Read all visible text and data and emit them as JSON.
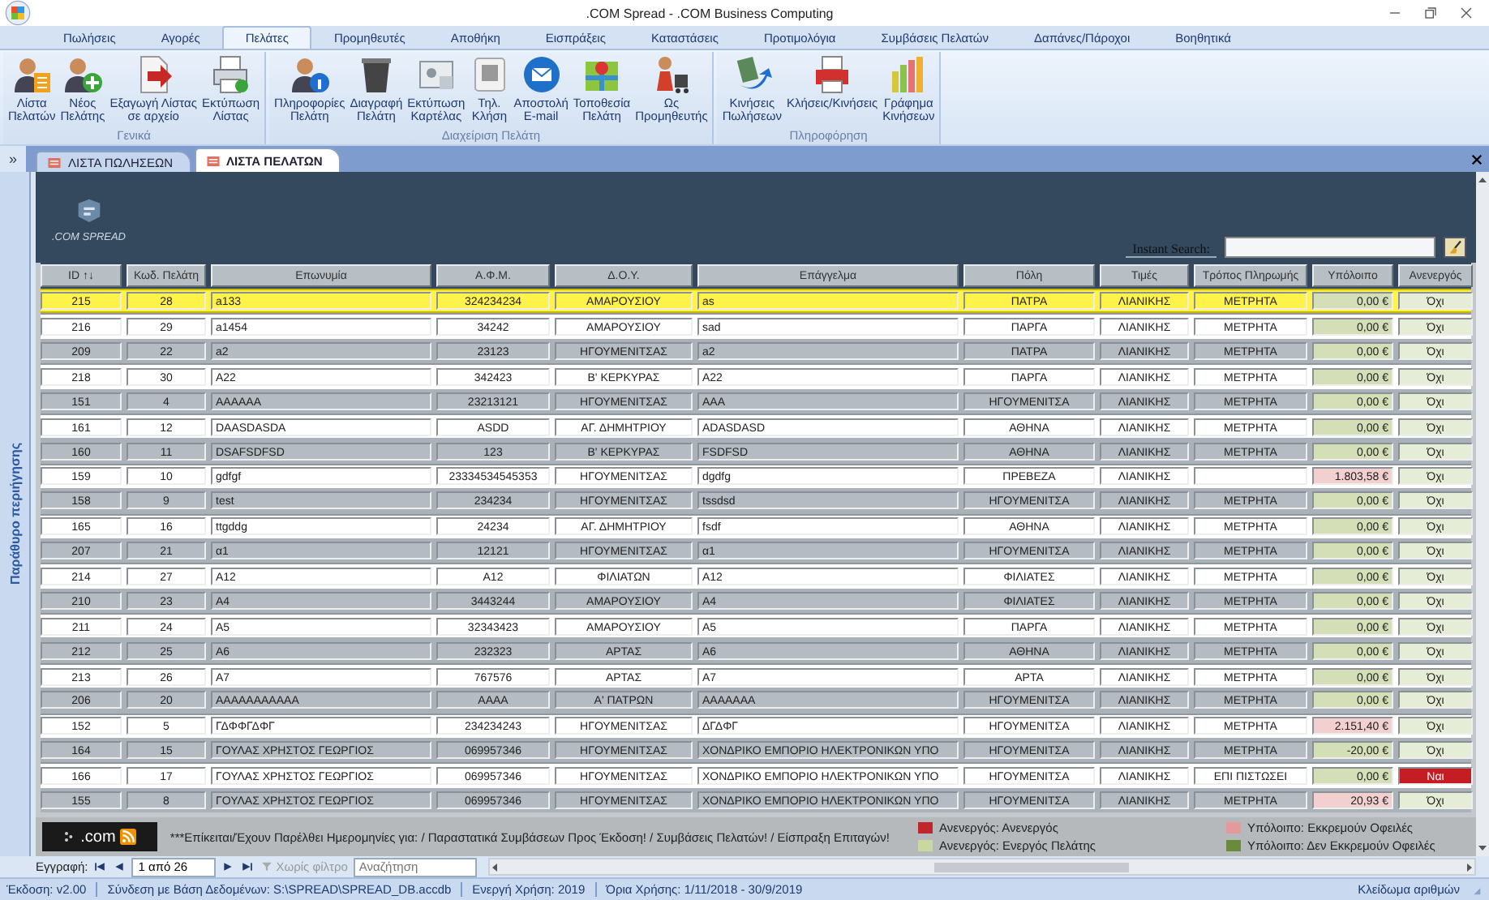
{
  "window": {
    "title": ".COM Spread - .COM Business Computing"
  },
  "ribbon_tabs": [
    {
      "label": "Πωλήσεις",
      "selected": false
    },
    {
      "label": "Αγορές",
      "selected": false
    },
    {
      "label": "Πελάτες",
      "selected": true
    },
    {
      "label": "Προμηθευτές",
      "selected": false
    },
    {
      "label": "Αποθήκη",
      "selected": false
    },
    {
      "label": "Εισπράξεις",
      "selected": false
    },
    {
      "label": "Καταστάσεις",
      "selected": false
    },
    {
      "label": "Προτιμολόγια",
      "selected": false
    },
    {
      "label": "Συμβάσεις Πελατών",
      "selected": false
    },
    {
      "label": "Δαπάνες/Πάροχοι",
      "selected": false
    },
    {
      "label": "Βοηθητικά",
      "selected": false
    }
  ],
  "ribbon_groups": [
    {
      "title": "Γενικά",
      "buttons": [
        {
          "label": [
            "Λίστα",
            "Πελατών"
          ]
        },
        {
          "label": [
            "Νέος",
            "Πελάτης"
          ]
        },
        {
          "label": [
            "Εξαγωγή Λίστας",
            "σε αρχείο"
          ]
        },
        {
          "label": [
            "Εκτύπωση",
            "Λίστας"
          ]
        }
      ]
    },
    {
      "title": "Διαχείριση Πελάτη",
      "buttons": [
        {
          "label": [
            "Πληροφορίες",
            "Πελάτη"
          ]
        },
        {
          "label": [
            "Διαγραφή",
            "Πελάτη"
          ]
        },
        {
          "label": [
            "Εκτύπωση",
            "Καρτέλας"
          ]
        },
        {
          "label": [
            "Τηλ.",
            "Κλήση"
          ]
        },
        {
          "label": [
            "Αποστολή",
            "E-mail"
          ]
        },
        {
          "label": [
            "Τοποθεσία",
            "Πελάτη"
          ]
        },
        {
          "label": [
            "Ως",
            "Προμηθευτής"
          ]
        }
      ]
    },
    {
      "title": "Πληροφόρηση",
      "buttons": [
        {
          "label": [
            "Κινήσεις",
            "Πωλήσεων"
          ]
        },
        {
          "label": [
            "Κλήσεις/Κινήσεις"
          ]
        },
        {
          "label": [
            "Γράφημα",
            "Κινήσεων"
          ]
        }
      ]
    }
  ],
  "doc_tabs": [
    {
      "label": "ΛΙΣΤΑ ΠΩΛΗΣΕΩΝ",
      "selected": false
    },
    {
      "label": "ΛΙΣΤΑ ΠΕΛΑΤΩΝ",
      "selected": true
    }
  ],
  "nav_pane": {
    "expand": "»",
    "label": "Παράθυρο περιήγησης"
  },
  "logo": ".COM SPREAD",
  "search": {
    "label": "Instant Search:"
  },
  "columns": [
    "ID ↑↓",
    "Κωδ. Πελάτη",
    "Επωνυμία",
    "Α.Φ.Μ.",
    "Δ.Ο.Υ.",
    "Επάγγελμα",
    "Πόλη",
    "Τιμές",
    "Τρόπος Πληρωμής",
    "Υπόλοιπο",
    "Ανενεργός"
  ],
  "rows": [
    {
      "id": "215",
      "code": "28",
      "name": "a133",
      "afm": "324234234",
      "doy": "ΑΜΑΡΟΥΣΙΟΥ",
      "profession": "as",
      "city": "ΠΑΤΡΑ",
      "prices": "ΛΙΑΝΙΚΗΣ",
      "payment": "ΜΕΤΡΗΤΑ",
      "balance": "0,00 €",
      "owed": false,
      "inactive_text": "Όχι",
      "inactive": false,
      "selected": true
    },
    {
      "id": "216",
      "code": "29",
      "name": "a1454",
      "afm": "34242",
      "doy": "ΑΜΑΡΟΥΣΙΟΥ",
      "profession": "sad",
      "city": "ΠΑΡΓΑ",
      "prices": "ΛΙΑΝΙΚΗΣ",
      "payment": "ΜΕΤΡΗΤΑ",
      "balance": "0,00 €",
      "owed": false,
      "inactive_text": "Όχι",
      "inactive": false,
      "selected": false
    },
    {
      "id": "209",
      "code": "22",
      "name": "a2",
      "afm": "23123",
      "doy": "ΗΓΟΥΜΕΝΙΤΣΑΣ",
      "profession": "a2",
      "city": "ΠΑΤΡΑ",
      "prices": "ΛΙΑΝΙΚΗΣ",
      "payment": "ΜΕΤΡΗΤΑ",
      "balance": "0,00 €",
      "owed": false,
      "inactive_text": "Όχι",
      "inactive": false,
      "selected": false
    },
    {
      "id": "218",
      "code": "30",
      "name": "A22",
      "afm": "342423",
      "doy": "Β' ΚΕΡΚΥΡΑΣ",
      "profession": "A22",
      "city": "ΠΑΡΓΑ",
      "prices": "ΛΙΑΝΙΚΗΣ",
      "payment": "ΜΕΤΡΗΤΑ",
      "balance": "0,00 €",
      "owed": false,
      "inactive_text": "Όχι",
      "inactive": false,
      "selected": false
    },
    {
      "id": "151",
      "code": "4",
      "name": "AAAAAA",
      "afm": "23213121",
      "doy": "ΗΓΟΥΜΕΝΙΤΣΑΣ",
      "profession": "AAA",
      "city": "ΗΓΟΥΜΕΝΙΤΣΑ",
      "prices": "ΛΙΑΝΙΚΗΣ",
      "payment": "ΜΕΤΡΗΤΑ",
      "balance": "0,00 €",
      "owed": false,
      "inactive_text": "Όχι",
      "inactive": false,
      "selected": false
    },
    {
      "id": "161",
      "code": "12",
      "name": "DAASDASDA",
      "afm": "ASDD",
      "doy": "ΑΓ. ΔΗΜΗΤΡΙΟΥ",
      "profession": "ADASDASD",
      "city": "ΑΘΗΝΑ",
      "prices": "ΛΙΑΝΙΚΗΣ",
      "payment": "ΜΕΤΡΗΤΑ",
      "balance": "0,00 €",
      "owed": false,
      "inactive_text": "Όχι",
      "inactive": false,
      "selected": false
    },
    {
      "id": "160",
      "code": "11",
      "name": "DSAFSDFSD",
      "afm": "123",
      "doy": "Β' ΚΕΡΚΥΡΑΣ",
      "profession": "FSDFSD",
      "city": "ΑΘΗΝΑ",
      "prices": "ΛΙΑΝΙΚΗΣ",
      "payment": "ΜΕΤΡΗΤΑ",
      "balance": "0,00 €",
      "owed": false,
      "inactive_text": "Όχι",
      "inactive": false,
      "selected": false
    },
    {
      "id": "159",
      "code": "10",
      "name": "gdfgf",
      "afm": "23334534545353",
      "doy": "ΗΓΟΥΜΕΝΙΤΣΑΣ",
      "profession": "dgdfg",
      "city": "ΠΡΕΒΕΖΑ",
      "prices": "ΛΙΑΝΙΚΗΣ",
      "payment": "",
      "balance": "1.803,58 €",
      "owed": true,
      "inactive_text": "Όχι",
      "inactive": false,
      "selected": false
    },
    {
      "id": "158",
      "code": "9",
      "name": "test",
      "afm": "234234",
      "doy": "ΗΓΟΥΜΕΝΙΤΣΑΣ",
      "profession": "tssdsd",
      "city": "ΗΓΟΥΜΕΝΙΤΣΑ",
      "prices": "ΛΙΑΝΙΚΗΣ",
      "payment": "ΜΕΤΡΗΤΑ",
      "balance": "0,00 €",
      "owed": false,
      "inactive_text": "Όχι",
      "inactive": false,
      "selected": false
    },
    {
      "id": "165",
      "code": "16",
      "name": "ttgddg",
      "afm": "24234",
      "doy": "ΑΓ. ΔΗΜΗΤΡΙΟΥ",
      "profession": "fsdf",
      "city": "ΑΘΗΝΑ",
      "prices": "ΛΙΑΝΙΚΗΣ",
      "payment": "ΜΕΤΡΗΤΑ",
      "balance": "0,00 €",
      "owed": false,
      "inactive_text": "Όχι",
      "inactive": false,
      "selected": false
    },
    {
      "id": "207",
      "code": "21",
      "name": "α1",
      "afm": "12121",
      "doy": "ΗΓΟΥΜΕΝΙΤΣΑΣ",
      "profession": "α1",
      "city": "ΗΓΟΥΜΕΝΙΤΣΑ",
      "prices": "ΛΙΑΝΙΚΗΣ",
      "payment": "ΜΕΤΡΗΤΑ",
      "balance": "0,00 €",
      "owed": false,
      "inactive_text": "Όχι",
      "inactive": false,
      "selected": false
    },
    {
      "id": "214",
      "code": "27",
      "name": "A12",
      "afm": "A12",
      "doy": "ΦΙΛΙΑΤΩΝ",
      "profession": "A12",
      "city": "ΦΙΛΙΑΤΕΣ",
      "prices": "ΛΙΑΝΙΚΗΣ",
      "payment": "ΜΕΤΡΗΤΑ",
      "balance": "0,00 €",
      "owed": false,
      "inactive_text": "Όχι",
      "inactive": false,
      "selected": false
    },
    {
      "id": "210",
      "code": "23",
      "name": "A4",
      "afm": "3443244",
      "doy": "ΑΜΑΡΟΥΣΙΟΥ",
      "profession": "A4",
      "city": "ΦΙΛΙΑΤΕΣ",
      "prices": "ΛΙΑΝΙΚΗΣ",
      "payment": "ΜΕΤΡΗΤΑ",
      "balance": "0,00 €",
      "owed": false,
      "inactive_text": "Όχι",
      "inactive": false,
      "selected": false
    },
    {
      "id": "211",
      "code": "24",
      "name": "A5",
      "afm": "32343423",
      "doy": "ΑΜΑΡΟΥΣΙΟΥ",
      "profession": "A5",
      "city": "ΠΑΡΓΑ",
      "prices": "ΛΙΑΝΙΚΗΣ",
      "payment": "ΜΕΤΡΗΤΑ",
      "balance": "0,00 €",
      "owed": false,
      "inactive_text": "Όχι",
      "inactive": false,
      "selected": false
    },
    {
      "id": "212",
      "code": "25",
      "name": "A6",
      "afm": "232323",
      "doy": "ΑΡΤΑΣ",
      "profession": "A6",
      "city": "ΑΘΗΝΑ",
      "prices": "ΛΙΑΝΙΚΗΣ",
      "payment": "ΜΕΤΡΗΤΑ",
      "balance": "0,00 €",
      "owed": false,
      "inactive_text": "Όχι",
      "inactive": false,
      "selected": false
    },
    {
      "id": "213",
      "code": "26",
      "name": "A7",
      "afm": "767576",
      "doy": "ΑΡΤΑΣ",
      "profession": "A7",
      "city": "ΑΡΤΑ",
      "prices": "ΛΙΑΝΙΚΗΣ",
      "payment": "ΜΕΤΡΗΤΑ",
      "balance": "0,00 €",
      "owed": false,
      "inactive_text": "Όχι",
      "inactive": false,
      "selected": false
    },
    {
      "id": "206",
      "code": "20",
      "name": "AAAAAAAAAAA",
      "afm": "AAAA",
      "doy": "Α' ΠΑΤΡΩΝ",
      "profession": "AAAAAAA",
      "city": "ΗΓΟΥΜΕΝΙΤΣΑ",
      "prices": "ΛΙΑΝΙΚΗΣ",
      "payment": "ΜΕΤΡΗΤΑ",
      "balance": "0,00 €",
      "owed": false,
      "inactive_text": "Όχι",
      "inactive": false,
      "selected": false
    },
    {
      "id": "152",
      "code": "5",
      "name": "ΓΔΦΦΓΔΦΓ",
      "afm": "234234243",
      "doy": "ΗΓΟΥΜΕΝΙΤΣΑΣ",
      "profession": "ΔΓΔΦΓ",
      "city": "ΗΓΟΥΜΕΝΙΤΣΑ",
      "prices": "ΛΙΑΝΙΚΗΣ",
      "payment": "ΜΕΤΡΗΤΑ",
      "balance": "2.151,40 €",
      "owed": true,
      "inactive_text": "Όχι",
      "inactive": false,
      "selected": false
    },
    {
      "id": "164",
      "code": "15",
      "name": "ΓΟΥΛΑΣ  ΧΡΗΣΤΟΣ ΓΕΩΡΓΙΟΣ",
      "afm": "069957346",
      "doy": "ΗΓΟΥΜΕΝΙΤΣΑΣ",
      "profession": "ΧΟΝΔΡΙΚΟ ΕΜΠΟΡΙΟ ΗΛΕΚΤΡΟΝΙΚΩΝ ΥΠΟ",
      "city": "ΗΓΟΥΜΕΝΙΤΣΑ",
      "prices": "ΛΙΑΝΙΚΗΣ",
      "payment": "ΜΕΤΡΗΤΑ",
      "balance": "-20,00 €",
      "owed": false,
      "inactive_text": "Όχι",
      "inactive": false,
      "selected": false
    },
    {
      "id": "166",
      "code": "17",
      "name": "ΓΟΥΛΑΣ  ΧΡΗΣΤΟΣ ΓΕΩΡΓΙΟΣ",
      "afm": "069957346",
      "doy": "ΗΓΟΥΜΕΝΙΤΣΑΣ",
      "profession": "ΧΟΝΔΡΙΚΟ ΕΜΠΟΡΙΟ ΗΛΕΚΤΡΟΝΙΚΩΝ ΥΠΟ",
      "city": "ΗΓΟΥΜΕΝΙΤΣΑ",
      "prices": "ΛΙΑΝΙΚΗΣ",
      "payment": "ΕΠΙ ΠΙΣΤΩΣΕΙ",
      "balance": "0,00 €",
      "owed": false,
      "inactive_text": "Ναι",
      "inactive": true,
      "selected": false
    },
    {
      "id": "155",
      "code": "8",
      "name": "ΓΟΥΛΑΣ  ΧΡΗΣΤΟΣ ΓΕΩΡΓΙΟΣ",
      "afm": "069957346",
      "doy": "ΗΓΟΥΜΕΝΙΤΣΑΣ",
      "profession": "ΧΟΝΔΡΙΚΟ ΕΜΠΟΡΙΟ ΗΛΕΚΤΡΟΝΙΚΩΝ ΥΠΟ",
      "city": "ΗΓΟΥΜΕΝΙΤΣΑ",
      "prices": "ΛΙΑΝΙΚΗΣ",
      "payment": "ΜΕΤΡΗΤΑ",
      "balance": "20,93 €",
      "owed": true,
      "inactive_text": "Όχι",
      "inactive": false,
      "selected": false
    }
  ],
  "footer": {
    "logo": ".com",
    "message": "***Επίκειται/Έχουν Παρέλθει Ημερομηνίες για:  / Παραστατικά Συμβάσεων Προς Έκδοση! / Συμβάσεις Πελατών! / Είσπραξη Επιταγών!",
    "legend": [
      {
        "label": "Ανενεργός: Ανενεργός",
        "color": "#c0272d"
      },
      {
        "label": "Ανενεργός: Ενεργός Πελάτης",
        "color": "#c8d8a0"
      },
      {
        "label": "Υπόλοιπο: Εκκρεμούν Οφειλές",
        "color": "#e49a9a"
      },
      {
        "label": "Υπόλοιπο: Δεν Εκκρεμούν Οφειλές",
        "color": "#6b8b3c"
      }
    ]
  },
  "record_nav": {
    "label": "Εγγραφή:",
    "position": "1 από 26",
    "filter": "Χωρίς φίλτρο",
    "filter_disabled": true,
    "search": {
      "placeholder": "Αναζήτηση"
    }
  },
  "status_bar": {
    "items": [
      "Έκδοση: v2.00",
      "Σύνδεση με Βάση Δεδομένων: S:\\SPREAD\\SPREAD_DB.accdb",
      "Ενεργή Χρήση: 2019",
      "Όρια Χρήσης: 1/11/2018 - 30/9/2019"
    ],
    "right": "Κλείδωμα αριθμών"
  }
}
